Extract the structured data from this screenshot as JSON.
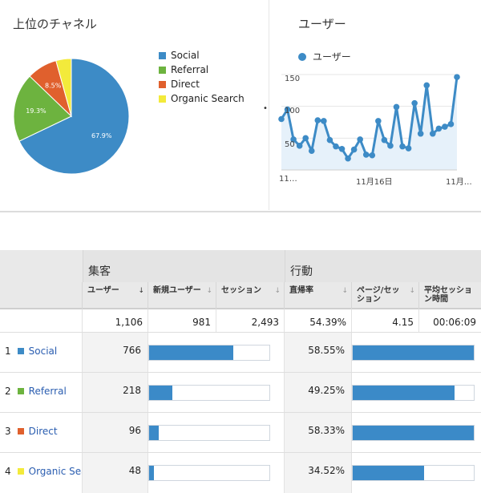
{
  "channels_card": {
    "title": "上位のチャネル",
    "slices": [
      {
        "name": "Social",
        "share": 67.9,
        "label": "67.9%",
        "color": "#3d8bc6"
      },
      {
        "name": "Referral",
        "share": 19.3,
        "label": "19.3%",
        "color": "#6db33f"
      },
      {
        "name": "Direct",
        "share": 8.5,
        "label": "8.5%",
        "color": "#e0602d"
      },
      {
        "name": "Organic Search",
        "share": 4.3,
        "label": "",
        "color": "#f3ea3b"
      }
    ]
  },
  "users_card": {
    "title": "ユーザー",
    "legend": "ユーザー",
    "color": "#3d8bc6"
  },
  "chart_data": {
    "type": "line",
    "series": [
      {
        "name": "ユーザー",
        "values": [
          80,
          95,
          48,
          38,
          50,
          30,
          78,
          77,
          47,
          37,
          33,
          18,
          32,
          48,
          24,
          23,
          77,
          47,
          38,
          99,
          37,
          34,
          105,
          57,
          133,
          57,
          65,
          68,
          72,
          146
        ]
      }
    ],
    "y_ticks": [
      "50",
      "100",
      "150"
    ],
    "x_ticks": [
      "11…",
      "11月16日",
      "11月…"
    ],
    "ylim": [
      0,
      160
    ],
    "area_fill": true
  },
  "table": {
    "groups": {
      "acquisition": "集客",
      "behavior": "行動"
    },
    "headers": {
      "users": "ユーザー",
      "new_users": "新規ユーザー",
      "sessions": "セッション",
      "bounce_rate": "直帰率",
      "pages_per_session": "ページ/セッション",
      "avg_session": "平均セッション時間"
    },
    "totals": {
      "users": "1,106",
      "new_users": "981",
      "sessions": "2,493",
      "bounce_rate": "54.39%",
      "pages_per_session": "4.15",
      "avg_session": "00:06:09"
    },
    "rows": [
      {
        "index": "1",
        "name": "Social",
        "color": "#3d8bc6",
        "users": "766",
        "new_users_fraction": 0.7,
        "bounce_rate": "58.55%",
        "behavior_fraction": 1.0
      },
      {
        "index": "2",
        "name": "Referral",
        "color": "#6db33f",
        "users": "218",
        "new_users_fraction": 0.19,
        "bounce_rate": "49.25%",
        "behavior_fraction": 0.84
      },
      {
        "index": "3",
        "name": "Direct",
        "color": "#e0602d",
        "users": "96",
        "new_users_fraction": 0.08,
        "bounce_rate": "58.33%",
        "behavior_fraction": 1.0
      },
      {
        "index": "4",
        "name": "Organic Search",
        "color": "#f3ea3b",
        "users": "48",
        "new_users_fraction": 0.04,
        "bounce_rate": "34.52%",
        "behavior_fraction": 0.59
      }
    ]
  }
}
